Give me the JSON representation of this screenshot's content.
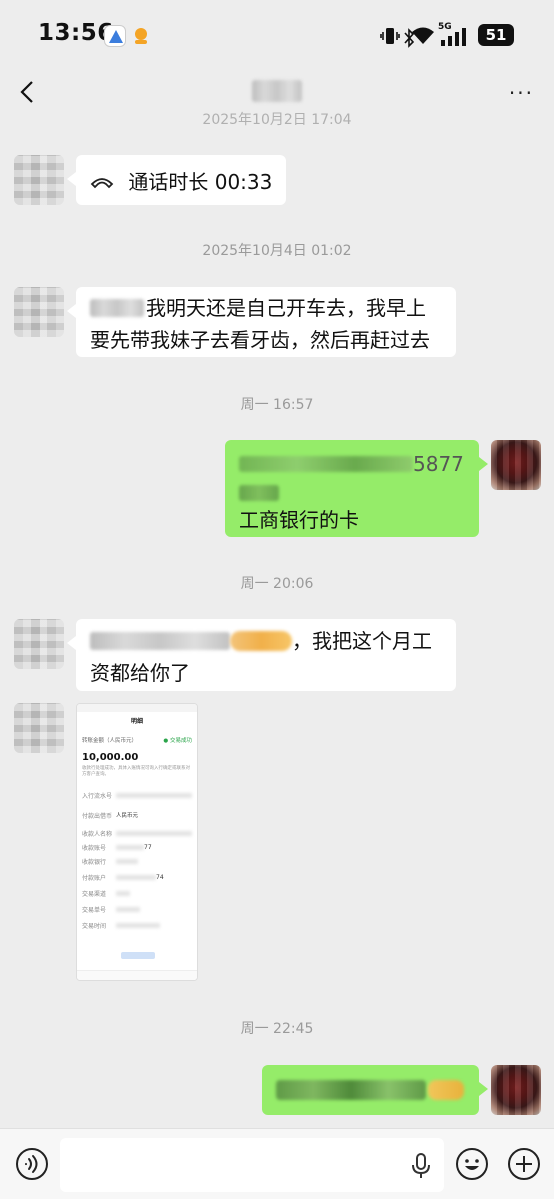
{
  "status_bar": {
    "time": "13:56",
    "battery": "51",
    "network": "5G"
  },
  "nav": {
    "back_icon": "chevron-left-icon",
    "more": "···"
  },
  "messages": {
    "ts_partial": "2025年10月2日 17:04",
    "call_label": "通话时长 00:33",
    "ts1": "2025年10月4日 01:02",
    "msg1_line1": "我明天还是自己开车去，我早上",
    "msg1_line2": "要先带我妹子去看牙齿，然后再赶过去",
    "ts2": "周一 16:57",
    "msg2_number_tail": "5877",
    "msg2_line3": "工商银行的卡",
    "ts3": "周一 20:06",
    "msg3_tail": "，我把这个月工",
    "msg3_line2": "资都给你了",
    "ts4": "周一 22:45"
  },
  "receipt": {
    "title": "明细",
    "header_label": "转账金额（人民币元）",
    "status": "交易成功",
    "amount": "10,000.00",
    "note": "收款行处理成功，具体入账情况可询入行确定或联系对方客户查询。",
    "rows": [
      {
        "label": "入行流水号",
        "value": ""
      },
      {
        "label": "付款出借币",
        "value": "人民币元"
      },
      {
        "label": "收款人名称",
        "value": ""
      },
      {
        "label": "收款账号",
        "value": "77"
      },
      {
        "label": "收款银行",
        "value": ""
      },
      {
        "label": "付款账户",
        "value": "74"
      },
      {
        "label": "交易渠道",
        "value": ""
      },
      {
        "label": "交易单号",
        "value": ""
      },
      {
        "label": "交易时间",
        "value": ""
      }
    ]
  },
  "colors": {
    "bg": "#ededed",
    "bubble_self": "#95ec69",
    "bubble_other": "#ffffff"
  }
}
